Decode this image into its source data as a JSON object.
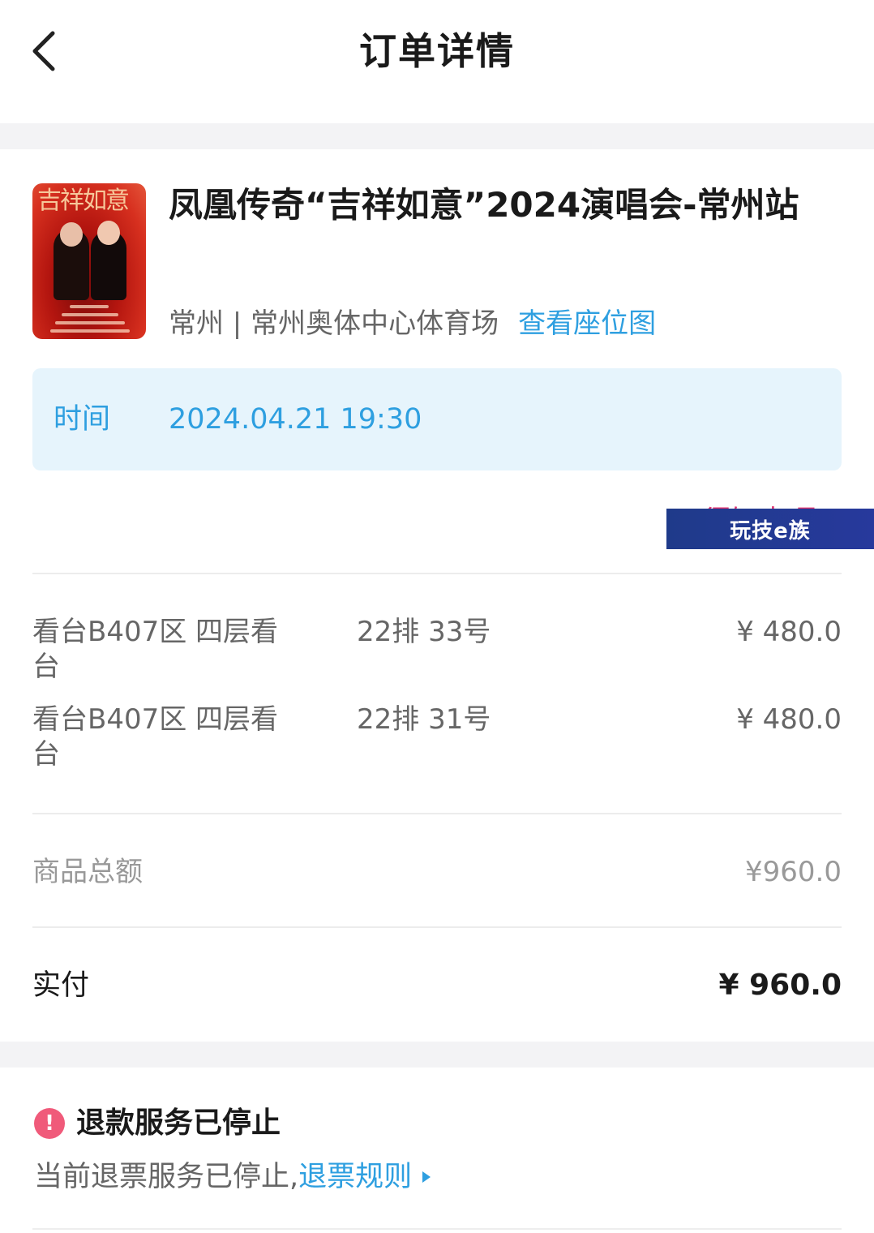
{
  "header": {
    "title": "订单详情",
    "back_icon": "chevron-left-icon"
  },
  "event": {
    "poster_title": "吉祥如意",
    "title": "凤凰传奇“吉祥如意”2024演唱会-常州站",
    "venue": "常州 | 常州奥体中心体育场",
    "seat_map_link": "查看座位图"
  },
  "time": {
    "label": "时间",
    "value": "2024.04.21 19:30"
  },
  "notice": {
    "label": "须知事项"
  },
  "tickets": [
    {
      "area": "看台B407区 四层看台",
      "seat": "22排 33号",
      "price": "¥ 480.0"
    },
    {
      "area": "看台B407区 四层看台",
      "seat": "22排 31号",
      "price": "¥ 480.0"
    }
  ],
  "watermark": "玩技e族",
  "summary": {
    "goods_total_label": "商品总额",
    "goods_total_value": "¥960.0",
    "paid_label": "实付",
    "paid_value": "¥ 960.0"
  },
  "refund": {
    "title": "退款服务已停止",
    "desc": "当前退票服务已停止,",
    "rules_link": "退票规则"
  },
  "colors": {
    "accent_blue": "#2e9fe0",
    "accent_pink": "#e0326f",
    "time_box_bg": "#e6f4fc",
    "warning": "#f05a7a"
  }
}
